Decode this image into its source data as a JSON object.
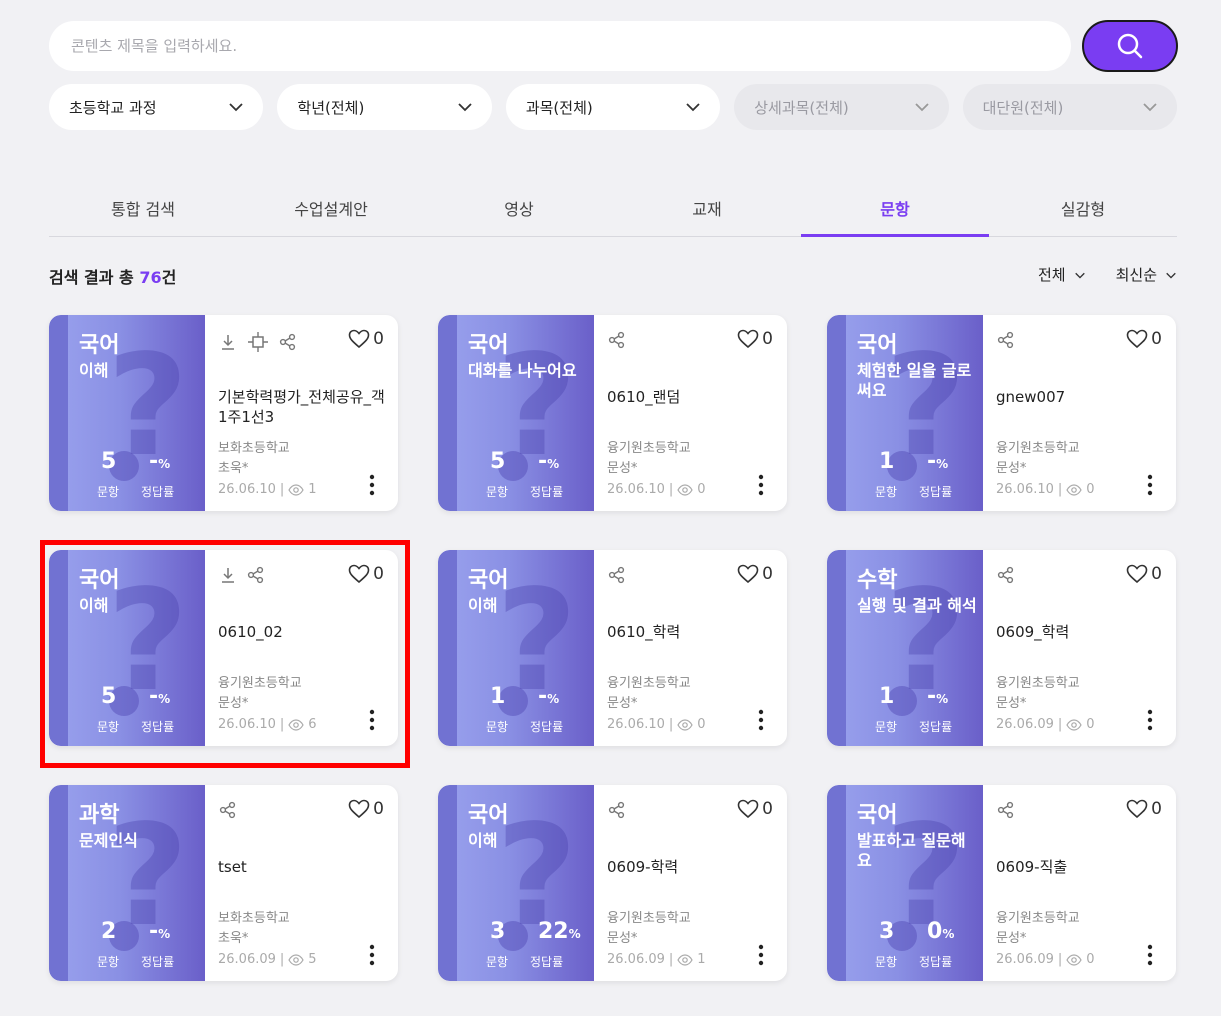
{
  "search": {
    "placeholder": "콘텐츠 제목을 입력하세요."
  },
  "filters": [
    {
      "label": "초등학교 과정",
      "disabled": false
    },
    {
      "label": "학년(전체)",
      "disabled": false
    },
    {
      "label": "과목(전체)",
      "disabled": false
    },
    {
      "label": "상세과목(전체)",
      "disabled": true
    },
    {
      "label": "대단원(전체)",
      "disabled": true
    }
  ],
  "tabs": [
    {
      "label": "통합 검색",
      "active": false
    },
    {
      "label": "수업설계안",
      "active": false
    },
    {
      "label": "영상",
      "active": false
    },
    {
      "label": "교재",
      "active": false
    },
    {
      "label": "문항",
      "active": true
    },
    {
      "label": "실감형",
      "active": false
    }
  ],
  "results": {
    "prefix": "검색 결과 총 ",
    "count": "76",
    "suffix": "건",
    "sort_filter": "전체",
    "sort_order": "최신순"
  },
  "stat_labels": {
    "count": "문항",
    "rate": "정답률"
  },
  "cards": [
    {
      "subject": "국어",
      "unit": "이해",
      "count": "5",
      "rate": "-",
      "unit_suffix": "%",
      "title": "기본학력평가_전체공유_객1주1선3",
      "school": "보화초등학교",
      "author": "초욱*",
      "date": "26.06.10",
      "views": "1",
      "likes": "0",
      "tools": [
        "download",
        "move",
        "share"
      ]
    },
    {
      "subject": "국어",
      "unit": "대화를 나누어요",
      "count": "5",
      "rate": "-",
      "unit_suffix": "%",
      "title": "0610_랜덤",
      "school": "융기원초등학교",
      "author": "문성*",
      "date": "26.06.10",
      "views": "0",
      "likes": "0",
      "tools": [
        "share"
      ]
    },
    {
      "subject": "국어",
      "unit": "체험한 일을 글로 써요",
      "count": "1",
      "rate": "-",
      "unit_suffix": "%",
      "title": "gnew007",
      "school": "융기원초등학교",
      "author": "문성*",
      "date": "26.06.10",
      "views": "0",
      "likes": "0",
      "tools": [
        "share"
      ]
    },
    {
      "subject": "국어",
      "unit": "이해",
      "count": "5",
      "rate": "-",
      "unit_suffix": "%",
      "title": "0610_02",
      "school": "융기원초등학교",
      "author": "문성*",
      "date": "26.06.10",
      "views": "6",
      "likes": "0",
      "tools": [
        "download",
        "share"
      ]
    },
    {
      "subject": "국어",
      "unit": "이해",
      "count": "1",
      "rate": "-",
      "unit_suffix": "%",
      "title": "0610_학력",
      "school": "융기원초등학교",
      "author": "문성*",
      "date": "26.06.10",
      "views": "0",
      "likes": "0",
      "tools": [
        "share"
      ]
    },
    {
      "subject": "수학",
      "unit": "실행 및 결과 해석",
      "count": "1",
      "rate": "-",
      "unit_suffix": "%",
      "title": "0609_학력",
      "school": "융기원초등학교",
      "author": "문성*",
      "date": "26.06.09",
      "views": "0",
      "likes": "0",
      "tools": [
        "share"
      ]
    },
    {
      "subject": "과학",
      "unit": "문제인식",
      "count": "2",
      "rate": "-",
      "unit_suffix": "%",
      "title": "tset",
      "school": "보화초등학교",
      "author": "초욱*",
      "date": "26.06.09",
      "views": "5",
      "likes": "0",
      "tools": [
        "share"
      ]
    },
    {
      "subject": "국어",
      "unit": "이해",
      "count": "3",
      "rate": "22",
      "unit_suffix": "%",
      "title": "0609-학력",
      "school": "융기원초등학교",
      "author": "문성*",
      "date": "26.06.09",
      "views": "1",
      "likes": "0",
      "tools": [
        "share"
      ]
    },
    {
      "subject": "국어",
      "unit": "발표하고 질문해요",
      "count": "3",
      "rate": "0",
      "unit_suffix": "%",
      "title": "0609-직출",
      "school": "융기원초등학교",
      "author": "문성*",
      "date": "26.06.09",
      "views": "0",
      "likes": "0",
      "tools": [
        "share"
      ]
    }
  ],
  "colors": {
    "accent": "#7a3df2",
    "highlight": "#ff0000"
  }
}
